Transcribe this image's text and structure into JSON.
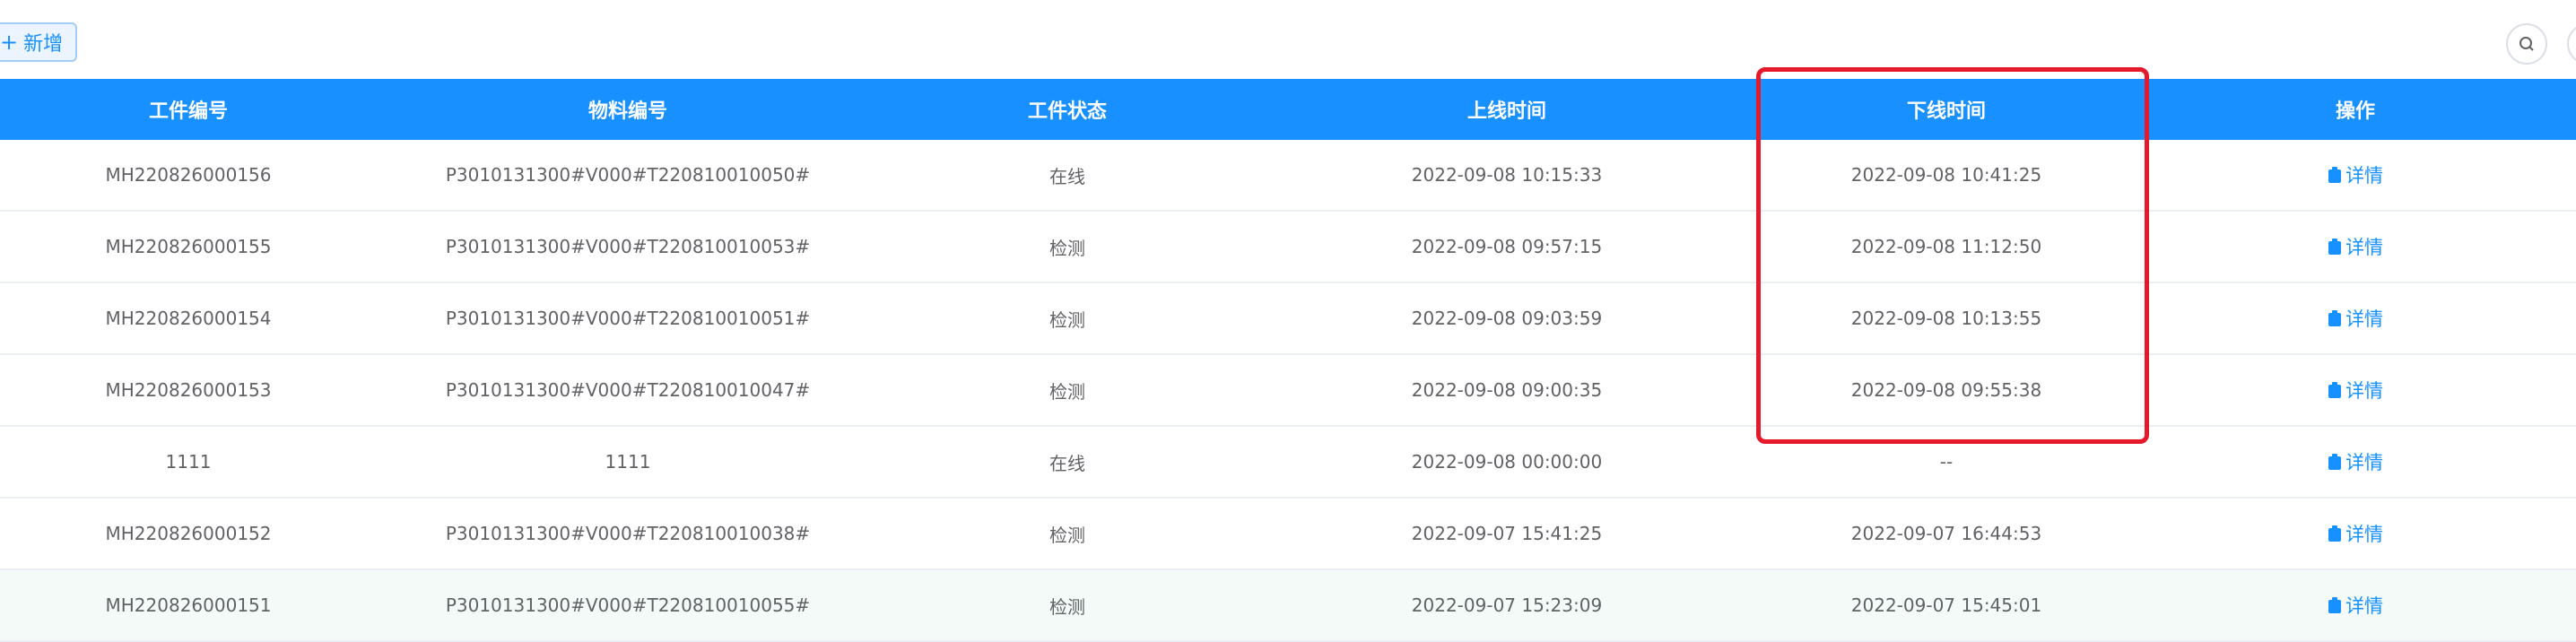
{
  "toolbar": {
    "add_label": "新增",
    "add_icon": "plus-icon",
    "search_icon": "search-icon"
  },
  "table": {
    "headers": [
      "工件编号",
      "物料编号",
      "工件状态",
      "上线时间",
      "下线时间",
      "操作"
    ],
    "rows": [
      {
        "part_no": "MH220826000156",
        "material_no": "P3010131300#V000#T220810010050#",
        "status": "在线",
        "online_time": "2022-09-08 10:15:33",
        "offline_time": "2022-09-08 10:41:25",
        "action": "详情"
      },
      {
        "part_no": "MH220826000155",
        "material_no": "P3010131300#V000#T220810010053#",
        "status": "检测",
        "online_time": "2022-09-08 09:57:15",
        "offline_time": "2022-09-08 11:12:50",
        "action": "详情"
      },
      {
        "part_no": "MH220826000154",
        "material_no": "P3010131300#V000#T220810010051#",
        "status": "检测",
        "online_time": "2022-09-08 09:03:59",
        "offline_time": "2022-09-08 10:13:55",
        "action": "详情"
      },
      {
        "part_no": "MH220826000153",
        "material_no": "P3010131300#V000#T220810010047#",
        "status": "检测",
        "online_time": "2022-09-08 09:00:35",
        "offline_time": "2022-09-08 09:55:38",
        "action": "详情"
      },
      {
        "part_no": "1111",
        "material_no": "1111",
        "status": "在线",
        "online_time": "2022-09-08 00:00:00",
        "offline_time": "--",
        "action": "详情"
      },
      {
        "part_no": "MH220826000152",
        "material_no": "P3010131300#V000#T220810010038#",
        "status": "检测",
        "online_time": "2022-09-07 15:41:25",
        "offline_time": "2022-09-07 16:44:53",
        "action": "详情"
      },
      {
        "part_no": "MH220826000151",
        "material_no": "P3010131300#V000#T220810010055#",
        "status": "检测",
        "online_time": "2022-09-07 15:23:09",
        "offline_time": "2022-09-07 15:45:01",
        "action": "详情"
      }
    ]
  },
  "colors": {
    "header_bg": "#1890ff",
    "link": "#1890ff",
    "highlight": "#e5192a",
    "zebra_row": "#f4faf8"
  }
}
